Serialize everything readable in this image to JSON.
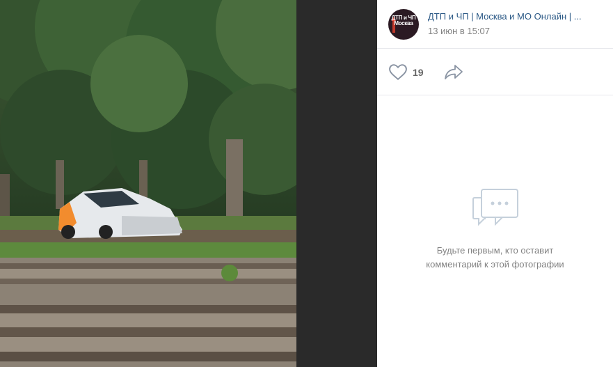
{
  "post": {
    "author": "ДТП и ЧП | Москва и МО Онлайн | ...",
    "avatar_text": "ДТП и ЧП\nМосква",
    "date": "13 июн в 15:07"
  },
  "actions": {
    "likes": "19",
    "like_icon": "heart-icon",
    "share_icon": "share-arrow-icon"
  },
  "comments": {
    "empty_icon": "speech-bubbles-icon",
    "empty_text": "Будьте первым, кто оставит\nкомментарий к этой фотографии"
  },
  "photo": {
    "subject": "photo-crashed-car-near-tram-tracks"
  },
  "colors": {
    "link": "#2a5885",
    "muted": "#828282",
    "background": "#ffffff"
  }
}
